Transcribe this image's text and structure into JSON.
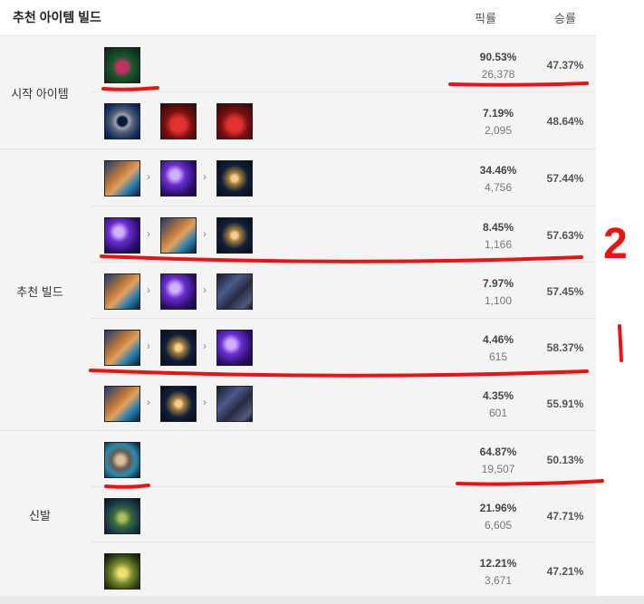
{
  "header": {
    "title": "추천 아이템 빌드",
    "pick_label": "픽률",
    "win_label": "승률"
  },
  "groups": {
    "start": {
      "label": "시작 아이템"
    },
    "build": {
      "label": "추천 빌드"
    },
    "boots": {
      "label": "신발"
    }
  },
  "rows": [
    {
      "pick": "90.53%",
      "count": "26,378",
      "win": "47.37%",
      "items": [
        "seal-icon"
      ]
    },
    {
      "pick": "7.19%",
      "count": "2,095",
      "win": "48.64%",
      "items": [
        "ring-icon",
        "potion-icon",
        "potion-icon"
      ]
    },
    {
      "pick": "34.46%",
      "count": "4,756",
      "win": "57.44%",
      "items": [
        "tome-icon",
        "wand-icon",
        "hourglass-icon"
      ]
    },
    {
      "pick": "8.45%",
      "count": "1,166",
      "win": "57.63%",
      "items": [
        "wand-icon",
        "tome-icon",
        "hourglass-icon"
      ]
    },
    {
      "pick": "7.97%",
      "count": "1,100",
      "win": "57.45%",
      "items": [
        "tome-icon",
        "wand-icon",
        "cloak-icon"
      ]
    },
    {
      "pick": "4.46%",
      "count": "615",
      "win": "58.37%",
      "items": [
        "tome-icon",
        "hourglass-icon",
        "wand-icon"
      ]
    },
    {
      "pick": "4.35%",
      "count": "601",
      "win": "55.91%",
      "items": [
        "tome-icon",
        "hourglass-icon",
        "cloak-icon"
      ]
    },
    {
      "pick": "64.87%",
      "count": "19,507",
      "win": "50.13%",
      "items": [
        "boots-icon"
      ]
    },
    {
      "pick": "21.96%",
      "count": "6,605",
      "win": "47.71%",
      "items": [
        "boots-green-icon"
      ]
    },
    {
      "pick": "12.21%",
      "count": "3,671",
      "win": "47.21%",
      "items": [
        "boots-gold-icon"
      ]
    }
  ],
  "arrow_glyph": "›",
  "annotations": {
    "label_2": "2",
    "label_1": "1"
  },
  "colors": {
    "annotation": "#ee1111"
  }
}
